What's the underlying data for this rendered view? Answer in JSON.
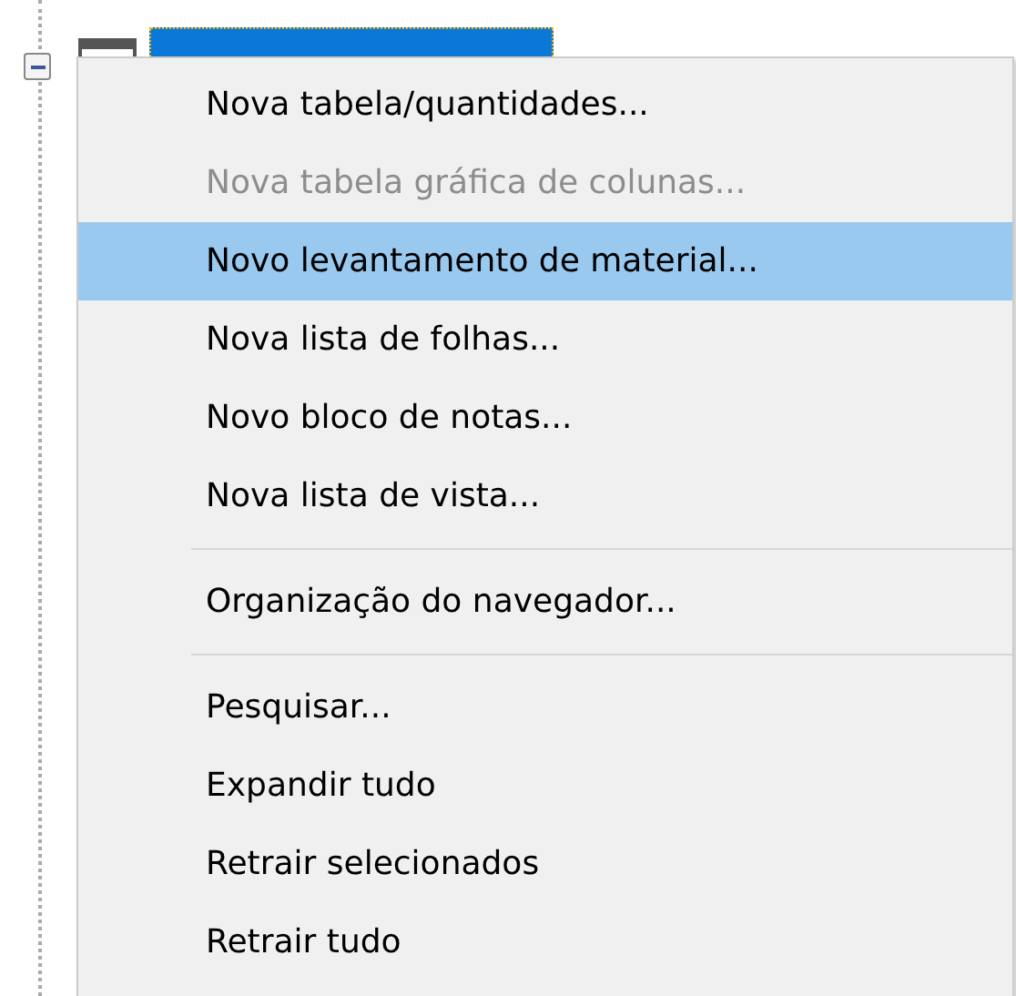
{
  "tree": {
    "node": {
      "expanded": true,
      "selected": true
    }
  },
  "context_menu": {
    "items": [
      {
        "kind": "item",
        "label": "Nova tabela/quantidades...",
        "disabled": false,
        "selected": false
      },
      {
        "kind": "item",
        "label": "Nova tabela gráfica de colunas...",
        "disabled": true,
        "selected": false
      },
      {
        "kind": "item",
        "label": "Novo levantamento de material...",
        "disabled": false,
        "selected": true
      },
      {
        "kind": "item",
        "label": "Nova lista de folhas...",
        "disabled": false,
        "selected": false
      },
      {
        "kind": "item",
        "label": "Novo bloco de notas...",
        "disabled": false,
        "selected": false
      },
      {
        "kind": "item",
        "label": "Nova lista de vista...",
        "disabled": false,
        "selected": false
      },
      {
        "kind": "separator"
      },
      {
        "kind": "item",
        "label": "Organização do navegador...",
        "disabled": false,
        "selected": false
      },
      {
        "kind": "separator"
      },
      {
        "kind": "item",
        "label": "Pesquisar...",
        "disabled": false,
        "selected": false
      },
      {
        "kind": "item",
        "label": "Expandir tudo",
        "disabled": false,
        "selected": false
      },
      {
        "kind": "item",
        "label": "Retrair selecionados",
        "disabled": false,
        "selected": false
      },
      {
        "kind": "item",
        "label": "Retrair tudo",
        "disabled": false,
        "selected": false
      }
    ]
  }
}
